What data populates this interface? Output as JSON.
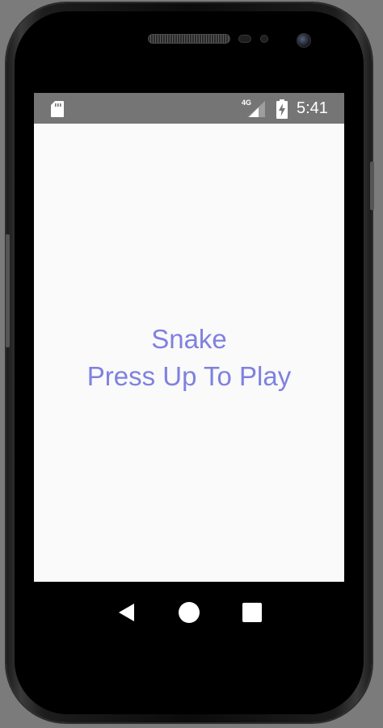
{
  "status_bar": {
    "network_type": "4G",
    "time": "5:41",
    "icons": [
      "sd-card-icon",
      "signal-icon",
      "battery-charging-icon"
    ]
  },
  "game": {
    "title": "Snake",
    "prompt": "Press Up To Play",
    "text_color": "#7f81df",
    "background_color": "#fafafa"
  },
  "nav_bar": {
    "buttons": [
      "back-icon",
      "home-icon",
      "recents-icon"
    ]
  },
  "colors": {
    "status_bar": "#757575",
    "device_background": "#7b7b7b"
  }
}
